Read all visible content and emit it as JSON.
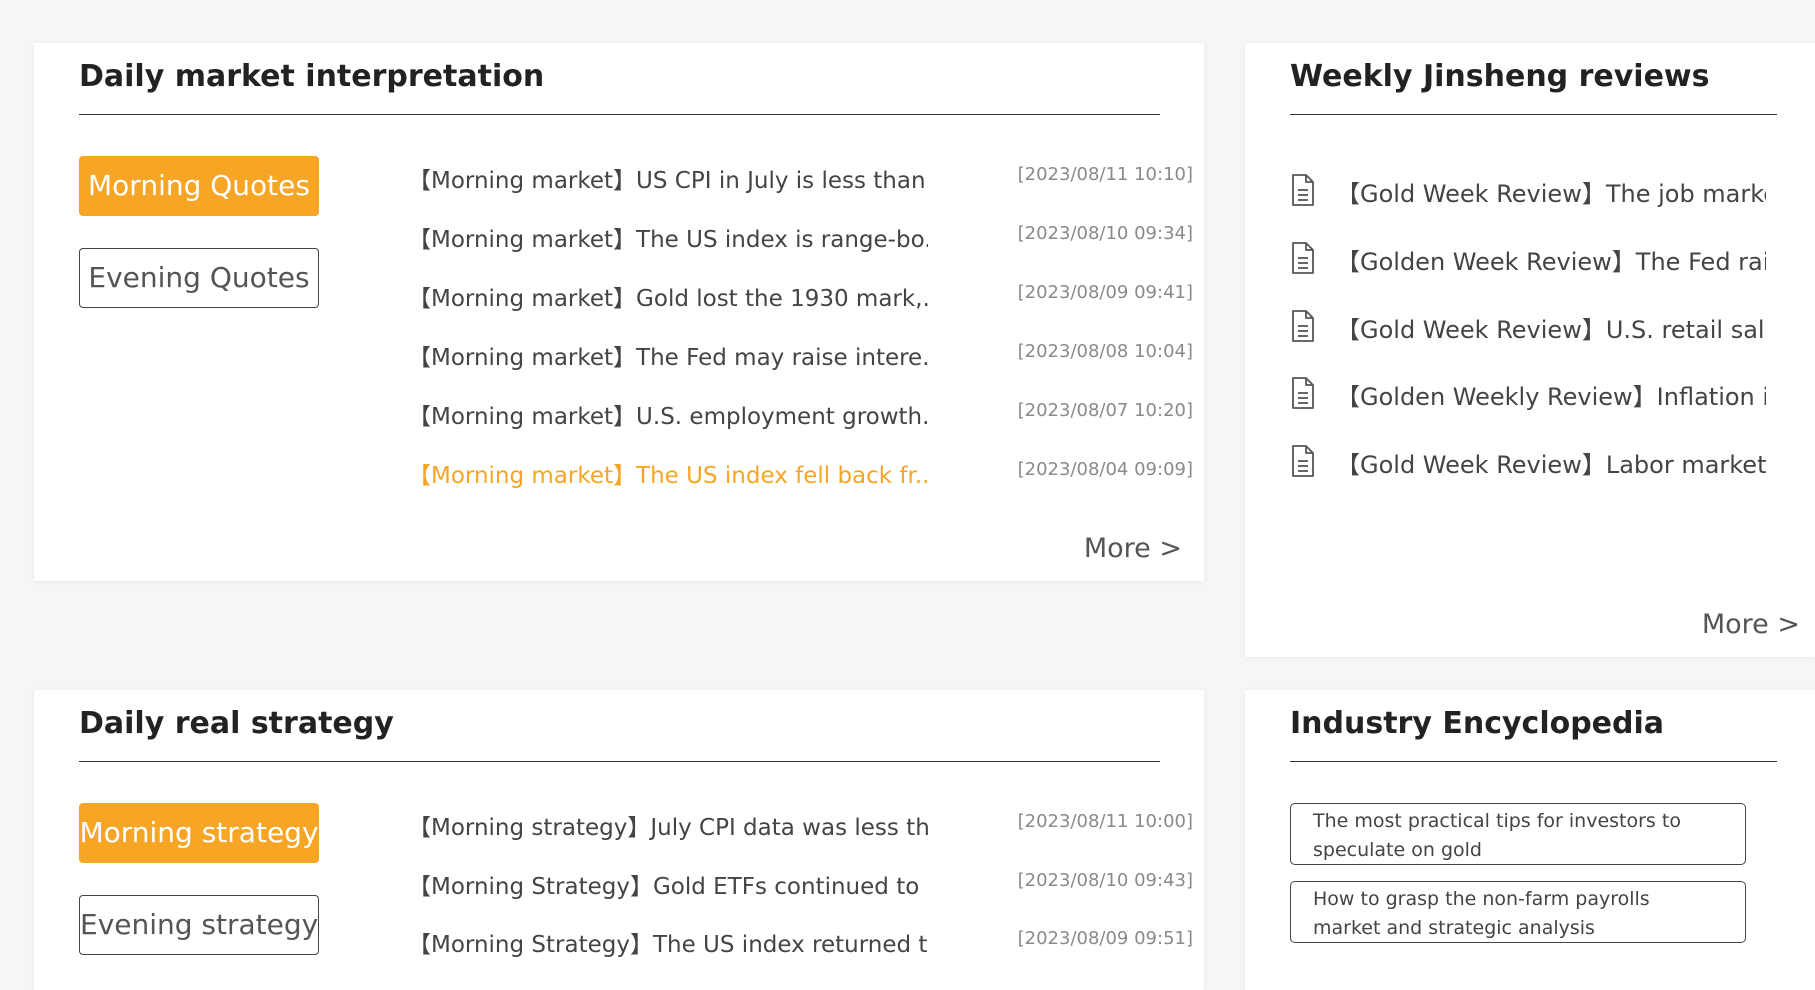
{
  "daily_market": {
    "title": "Daily market interpretation",
    "tabs": [
      {
        "label": "Morning Quotes"
      },
      {
        "label": "Evening Quotes"
      }
    ],
    "items": [
      {
        "title": "【Morning market】US CPI in July is less than...",
        "date": "[2023/08/11 10:10]"
      },
      {
        "title": "【Morning market】The US index is range-bo...",
        "date": "[2023/08/10 09:34]"
      },
      {
        "title": "【Morning market】Gold lost the 1930 mark,...",
        "date": "[2023/08/09 09:41]"
      },
      {
        "title": "【Morning market】The Fed may raise intere...",
        "date": "[2023/08/08 10:04]"
      },
      {
        "title": "【Morning market】U.S. employment growth...",
        "date": "[2023/08/07 10:20]"
      },
      {
        "title": "【Morning market】The US index fell back fr...",
        "date": "[2023/08/04 09:09]"
      }
    ],
    "more": "More >"
  },
  "weekly_reviews": {
    "title": "Weekly Jinsheng reviews",
    "items": [
      {
        "title": "【Gold Week Review】The job market i..."
      },
      {
        "title": "【Golden Week Review】The Fed raise..."
      },
      {
        "title": "【Gold Week Review】U.S. retail sales ..."
      },
      {
        "title": "【Golden Weekly Review】Inflation in J..."
      },
      {
        "title": "【Gold Week Review】Labor market d..."
      }
    ],
    "icon": "document-icon",
    "more": "More >"
  },
  "daily_strategy": {
    "title": "Daily real strategy",
    "tabs": [
      {
        "label": "Morning strategy"
      },
      {
        "label": "Evening strategy"
      }
    ],
    "items": [
      {
        "title": "【Morning strategy】July CPI data was less th...",
        "date": "[2023/08/11 10:00]"
      },
      {
        "title": "【Morning Strategy】Gold ETFs continued to ...",
        "date": "[2023/08/10 09:43]"
      },
      {
        "title": "【Morning Strategy】The US index returned t...",
        "date": "[2023/08/09 09:51]"
      }
    ]
  },
  "encyclopedia": {
    "title": "Industry Encyclopedia",
    "items": [
      {
        "title": "The most practical tips for investors to speculate on gold"
      },
      {
        "title": "How to grasp the non-farm payrolls market and strategic analysis"
      }
    ]
  },
  "colors": {
    "accent": "#f6a524",
    "text": "#444444",
    "date": "#8a8a8a"
  }
}
